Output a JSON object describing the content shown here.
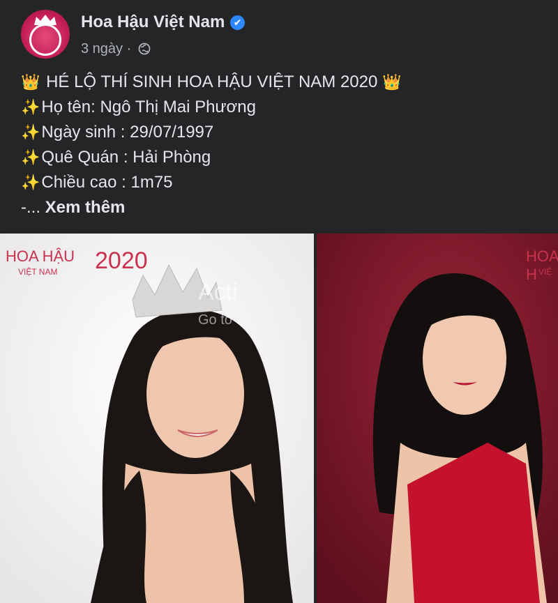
{
  "post": {
    "page_name": "Hoa Hậu Việt Nam",
    "verified": "✔",
    "time": "3 ngày",
    "separator": "·",
    "audience_icon": "globe-icon",
    "lines": [
      {
        "emoji": "👑",
        "text": "HÉ LỘ THÍ SINH HOA HẬU VIỆT NAM 2020",
        "emoji_end": "👑"
      },
      {
        "emoji": "✨",
        "text": "Họ tên: Ngô Thị Mai Phương"
      },
      {
        "emoji": "✨",
        "text": "Ngày sinh : 29/07/1997"
      },
      {
        "emoji": "✨",
        "text": "Quê Quán : Hải Phòng"
      },
      {
        "emoji": "✨",
        "text": "Chiều cao : 1m75"
      }
    ],
    "ellipsis": "-... ",
    "see_more": "Xem thêm"
  },
  "photos": {
    "left_watermark": {
      "top": "HOA HẬU",
      "bottom": "VIỆT NAM",
      "year": "2020"
    },
    "right_watermark": {
      "top": "HOA H",
      "bottom": "VIỆ"
    }
  },
  "overlay": {
    "activate": "Acti",
    "go_to": "Go to"
  },
  "colors": {
    "background": "#242526",
    "text": "#e4e6eb",
    "muted": "#b0b3b8",
    "brand": "#c8324e",
    "verified": "#2d88ff"
  }
}
